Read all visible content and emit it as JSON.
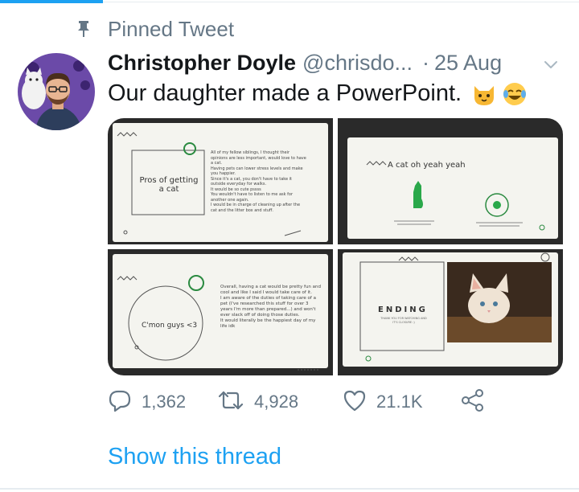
{
  "pinned": {
    "label": "Pinned Tweet",
    "icon": "pin-icon"
  },
  "tweet": {
    "display_name": "Christopher Doyle",
    "handle": "@chrisdo...",
    "separator": "·",
    "date": "25 Aug",
    "text": "Our daughter made a PowerPoint.",
    "emojis": [
      "cat-face-emoji",
      "laughing-tears-emoji"
    ]
  },
  "media": {
    "slides": [
      {
        "title": "Pros of getting a cat",
        "bullets": [
          "All of my fellow siblings, I thought their opinions are less important, would love to have a cat.",
          "Having pets can lower stress levels and make you happier.",
          "Since it's a cat, you don't have to take it outside everyday for walks.",
          "It would be so cute pssss",
          "You wouldn't have to listen to me ask for another one again.",
          "I would be in charge of cleaning up after the cat and the litter box and stuff."
        ]
      },
      {
        "title": "A cat oh yeah yeah"
      },
      {
        "title": "C'mon guys <3",
        "bullets": [
          "Overall, having a cat would be pretty fun and cool and like I said I would take care of it.",
          "I am aware of the duties of taking care of a pet (I've researched this stuff for over 3 years I'm more than prepared...) and won't ever slack off of doing those duties.",
          "It would literally be the happiest day of my life idk"
        ]
      },
      {
        "title": "ENDING",
        "subtitle": "THANK YOU FOR WATCHING AND IT'S CLOSURE :)"
      }
    ]
  },
  "actions": {
    "replies": "1,362",
    "retweets": "4,928",
    "likes": "21.1K"
  },
  "show_thread": "Show this thread",
  "colors": {
    "accent": "#1da1f2",
    "secondary_text": "#657786",
    "primary_text": "#14171a"
  }
}
